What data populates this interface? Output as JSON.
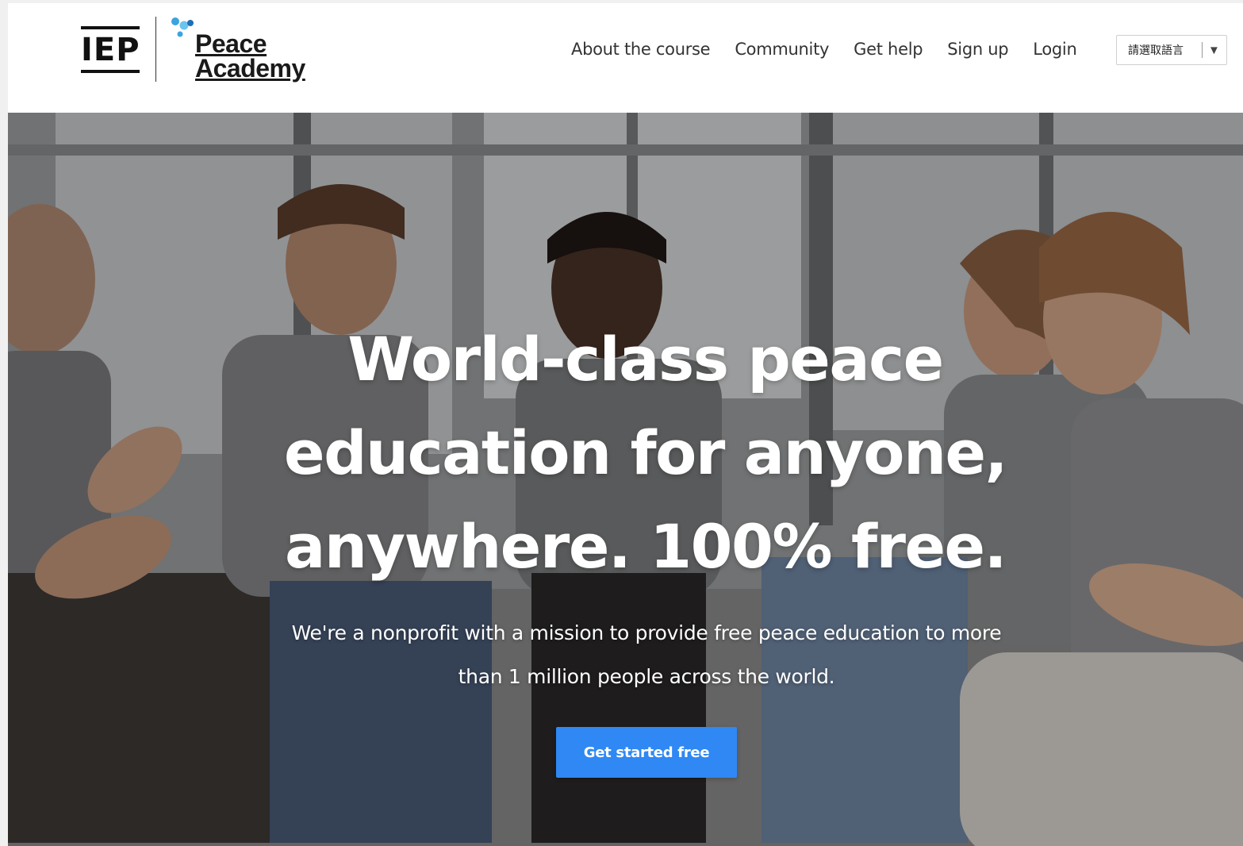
{
  "logo": {
    "org": "IEP",
    "product_line1": "Peace",
    "product_line2": "Academy",
    "dot_colors": [
      "#3ba3e0",
      "#1e6fb5",
      "#6cc3ef"
    ]
  },
  "nav": {
    "items": [
      {
        "label": "About the course"
      },
      {
        "label": "Community"
      },
      {
        "label": "Get help"
      },
      {
        "label": "Sign up"
      },
      {
        "label": "Login"
      }
    ],
    "language_select": {
      "value": "請選取語言",
      "caret": "▼"
    }
  },
  "hero": {
    "headline_line1": "World-class peace",
    "headline_line2": "education for anyone,",
    "headline_line3": "anywhere. 100% free.",
    "subtext": "We're a nonprofit with a mission to provide free peace education to more than 1 million people across the world.",
    "cta_label": "Get started free"
  },
  "colors": {
    "accent": "#2f88f3",
    "text": "#333333",
    "header_bg": "#ffffff"
  }
}
